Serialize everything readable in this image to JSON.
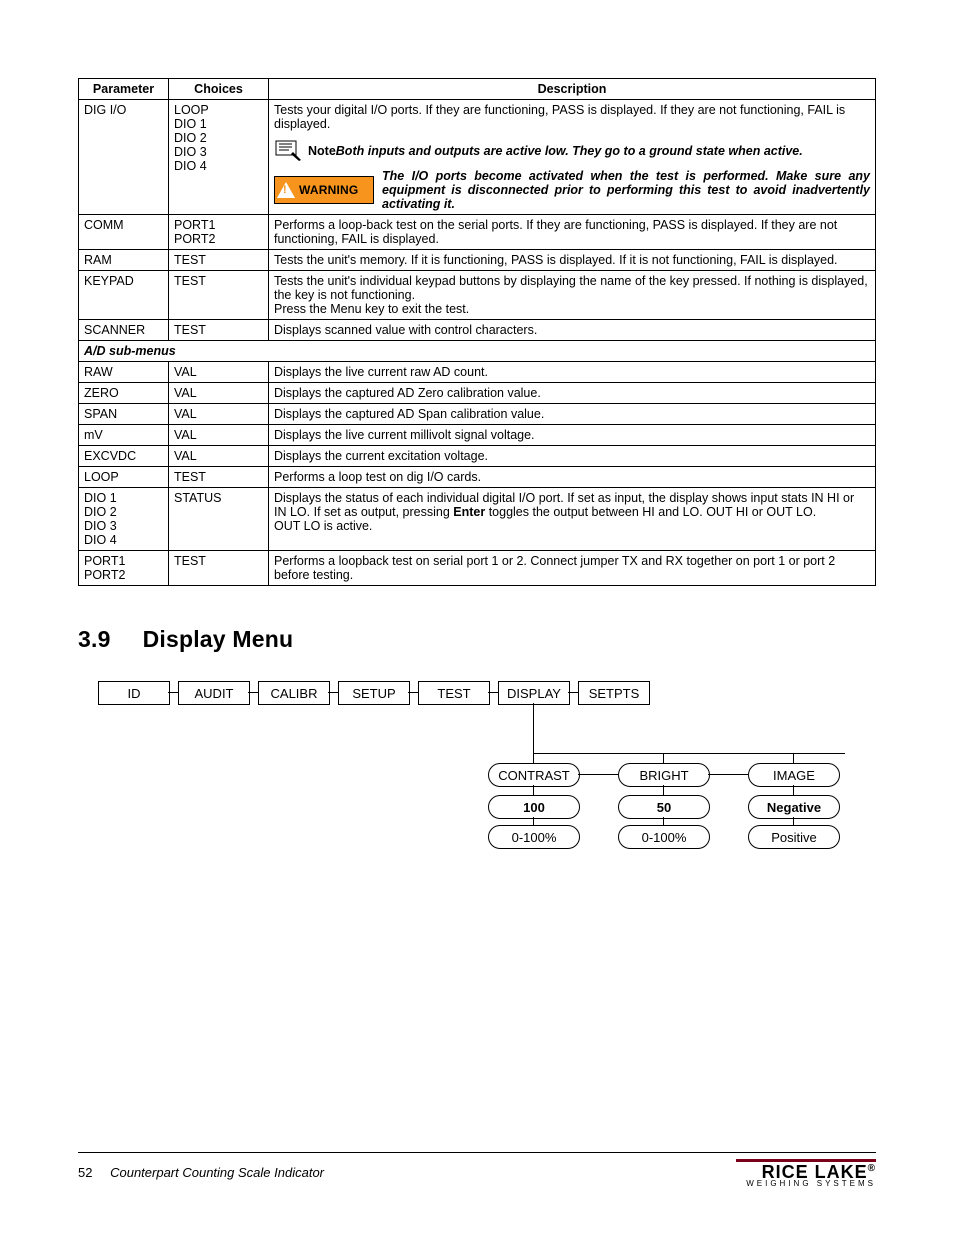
{
  "table": {
    "headers": {
      "param": "Parameter",
      "choices": "Choices",
      "desc": "Description"
    },
    "rows": {
      "digio": {
        "param": "DIG I/O",
        "choices": "LOOP\nDIO 1\nDIO 2\nDIO 3\nDIO 4",
        "desc_main": "Tests your digital I/O ports. If they are functioning, PASS is displayed. If they are not functioning, FAIL is displayed.",
        "note_label": "Note",
        "note_text": "Both inputs and outputs are active low. They go to a ground state when active.",
        "warn_label": "WARNING",
        "warn_text": "The I/O ports become activated when the test is performed. Make sure any equipment is disconnected prior to performing this test to avoid inadvertently activating it."
      },
      "comm": {
        "param": "COMM",
        "choices": "PORT1\nPORT2",
        "desc": "Performs a loop-back test on the serial ports. If they are functioning, PASS is displayed. If they are not functioning, FAIL is displayed."
      },
      "ram": {
        "param": "RAM",
        "choices": "TEST",
        "desc": "Tests the unit's memory. If it is functioning, PASS is displayed. If it is not functioning, FAIL is displayed."
      },
      "keypad": {
        "param": "KEYPAD",
        "choices": "TEST",
        "desc": "Tests the unit's individual keypad buttons by displaying the name of the key pressed. If nothing is displayed, the key is not functioning.\nPress the Menu key to exit the test."
      },
      "scanner": {
        "param": "SCANNER",
        "choices": "TEST",
        "desc": "Displays scanned value with control characters."
      },
      "subhead": "A/D sub-menus",
      "raw": {
        "param": "RAW",
        "choices": "VAL",
        "desc": "Displays the live current raw AD count."
      },
      "zero": {
        "param": "ZERO",
        "choices": "VAL",
        "desc": "Displays the captured AD Zero calibration value."
      },
      "span": {
        "param": "SPAN",
        "choices": "VAL",
        "desc": "Displays the captured AD Span calibration value."
      },
      "mv": {
        "param": "mV",
        "choices": "VAL",
        "desc": "Displays the live current millivolt signal voltage."
      },
      "exc": {
        "param": "EXCVDC",
        "choices": "VAL",
        "desc": "Displays the current excitation voltage."
      },
      "loop": {
        "param": "LOOP",
        "choices": "TEST",
        "desc": "Performs a loop test on dig I/O cards."
      },
      "dio": {
        "param": "DIO 1\nDIO 2\nDIO 3\nDIO 4",
        "choices": "STATUS",
        "desc_pre": "Displays the status of each individual digital I/O port. If set as input, the display shows input stats IN HI or IN LO. If set as output, pressing ",
        "desc_bold": "Enter",
        "desc_post": " toggles the output between HI and LO. OUT HI or OUT LO.\nOUT LO is active."
      },
      "port": {
        "param": "PORT1\nPORT2",
        "choices": "TEST",
        "desc": "Performs a loopback test on serial port 1 or 2. Connect jumper TX and RX together on port 1 or port 2 before testing."
      }
    }
  },
  "section": {
    "num": "3.9",
    "title": "Display Menu"
  },
  "menu": {
    "top": [
      "ID",
      "AUDIT",
      "CALIBR",
      "SETUP",
      "TEST",
      "DISPLAY",
      "SETPTS"
    ],
    "sub": [
      "CONTRAST",
      "BRIGHT",
      "IMAGE"
    ],
    "vals": [
      "100",
      "50",
      "Negative"
    ],
    "ranges": [
      "0-100%",
      "0-100%",
      "Positive"
    ]
  },
  "footer": {
    "page": "52",
    "title": "Counterpart Counting Scale Indicator",
    "logo_main": "RICE LAKE",
    "logo_sub": "WEIGHING SYSTEMS"
  }
}
